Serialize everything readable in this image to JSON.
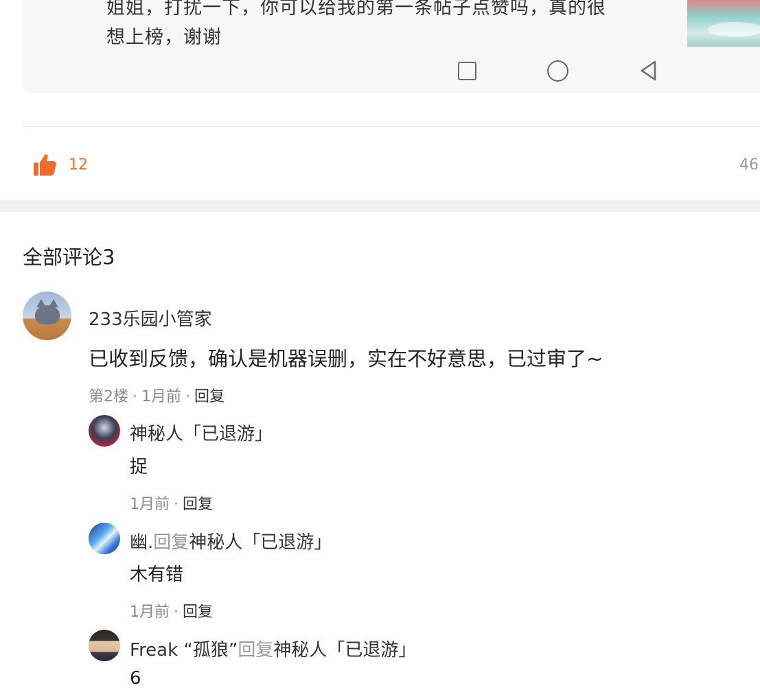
{
  "post": {
    "text_line1": "姐姐，打扰一下，你可以给我的第一条帖子点赞吗，真的很",
    "text_line2": "想上榜，谢谢"
  },
  "stats": {
    "like_count": "12",
    "right_count": "46"
  },
  "comments": {
    "title": "全部评论3",
    "main": {
      "author": "233乐园小管家",
      "body": "已收到反馈，确认是机器误删，实在不好意思，已过审了~",
      "floor": "第2楼",
      "time": "1月前",
      "reply_label": "回复"
    },
    "replies": [
      {
        "author": "神秘人「已退游」",
        "body": "捉",
        "time": "1月前",
        "reply_label": "回复"
      },
      {
        "author": "幽.",
        "reply_word": "回复",
        "target": "神秘人「已退游」",
        "body": "木有错",
        "time": "1月前",
        "reply_label": "回复"
      },
      {
        "author": "Freak “孤狼”",
        "reply_word": "回复",
        "target": "神秘人「已退游」",
        "body": "6"
      }
    ]
  },
  "colors": {
    "accent": "#f06b2a",
    "muted_text": "#9a9a9a",
    "section_gap": "#f2f2f2"
  },
  "icons": {
    "like": "thumbs-up-icon",
    "nav_recent": "square-icon",
    "nav_home": "circle-icon",
    "nav_back": "triangle-back-icon"
  }
}
